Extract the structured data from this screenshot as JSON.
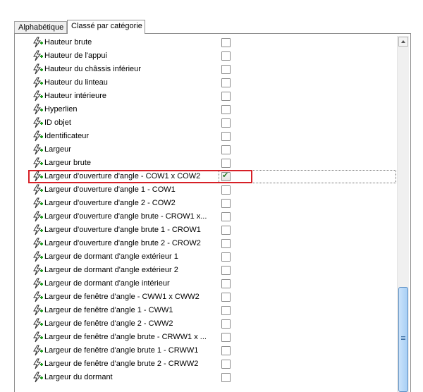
{
  "tabs": [
    {
      "label": "Alphabétique",
      "active": false
    },
    {
      "label": "Classé par catégorie",
      "active": true
    }
  ],
  "rows": [
    {
      "label": "Hauteur brute",
      "checked": false
    },
    {
      "label": "Hauteur de l'appui",
      "checked": false
    },
    {
      "label": "Hauteur du châssis inférieur",
      "checked": false
    },
    {
      "label": "Hauteur du linteau",
      "checked": false
    },
    {
      "label": "Hauteur intérieure",
      "checked": false
    },
    {
      "label": "Hyperlien",
      "checked": false
    },
    {
      "label": "ID objet",
      "checked": false
    },
    {
      "label": "Identificateur",
      "checked": false
    },
    {
      "label": "Largeur",
      "checked": false
    },
    {
      "label": "Largeur brute",
      "checked": false
    },
    {
      "label": "Largeur d'ouverture d'angle - COW1 x COW2",
      "checked": true,
      "selected": true
    },
    {
      "label": "Largeur d'ouverture d'angle 1 - COW1",
      "checked": false
    },
    {
      "label": "Largeur d'ouverture d'angle 2 - COW2",
      "checked": false
    },
    {
      "label": "Largeur d'ouverture d'angle brute - CROW1 x...",
      "checked": false
    },
    {
      "label": "Largeur d'ouverture d'angle brute 1 - CROW1",
      "checked": false
    },
    {
      "label": "Largeur d'ouverture d'angle brute 2 - CROW2",
      "checked": false
    },
    {
      "label": "Largeur de dormant d'angle extérieur 1",
      "checked": false
    },
    {
      "label": "Largeur de dormant d'angle extérieur 2",
      "checked": false
    },
    {
      "label": "Largeur de dormant d'angle intérieur",
      "checked": false
    },
    {
      "label": "Largeur de fenêtre d'angle - CWW1 x CWW2",
      "checked": false
    },
    {
      "label": "Largeur de fenêtre d'angle 1 - CWW1",
      "checked": false
    },
    {
      "label": "Largeur de fenêtre d'angle 2 - CWW2",
      "checked": false
    },
    {
      "label": "Largeur de fenêtre d'angle brute - CRWW1 x ...",
      "checked": false
    },
    {
      "label": "Largeur de fenêtre d'angle brute 1 - CRWW1",
      "checked": false
    },
    {
      "label": "Largeur de fenêtre d'angle brute 2 - CRWW2",
      "checked": false
    },
    {
      "label": "Largeur du dormant",
      "checked": false
    }
  ],
  "icons": {
    "row_icon": "lightning-plus-icon"
  },
  "colors": {
    "highlight": "#d62027",
    "scroll_thumb": "#a8cff5"
  }
}
